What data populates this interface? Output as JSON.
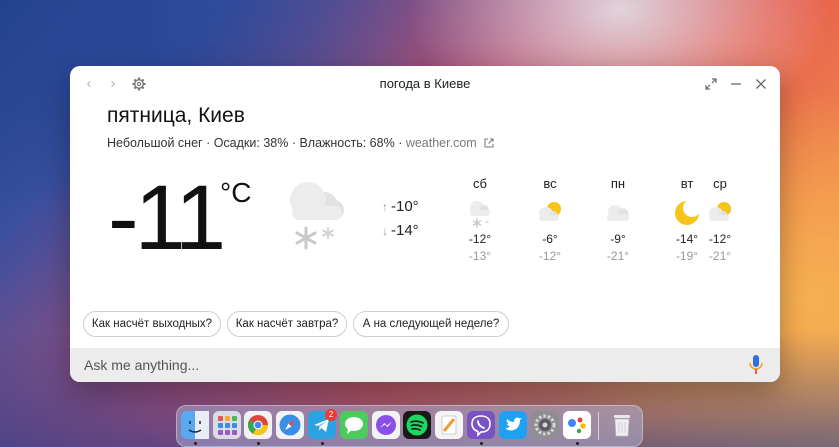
{
  "window": {
    "title": "погода в Киеве",
    "nav_back": "‹",
    "nav_forward": "›"
  },
  "weather": {
    "heading": "пятница, Киев",
    "condition": "Небольшой снег",
    "precip": "Осадки: 38%",
    "humidity": "Влажность: 68%",
    "separator": " · ",
    "source": "weather.com",
    "current_temp": "-11",
    "unit": "°C",
    "high": "-10°",
    "low": "-14°"
  },
  "forecast": [
    {
      "day": "сб",
      "icon": "snow-cloud-icon",
      "high": "-12°",
      "low": "-13°"
    },
    {
      "day": "вс",
      "icon": "partly-cloudy-icon",
      "high": "-6°",
      "low": "-12°"
    },
    {
      "day": "пн",
      "icon": "cloudy-icon",
      "high": "-9°",
      "low": "-21°"
    },
    {
      "day": "вт",
      "icon": "moon-icon",
      "high": "-14°",
      "low": "-19°"
    },
    {
      "day": "ср",
      "icon": "partly-cloudy-icon",
      "high": "-12°",
      "low": "-21°"
    }
  ],
  "suggestions": [
    "Как насчёт выходных?",
    "Как насчёт завтра?",
    "А на следующей неделе?"
  ],
  "ask": {
    "placeholder": "Ask me anything..."
  },
  "dock": {
    "telegram_badge": "2",
    "apps": [
      "finder",
      "launchpad",
      "chrome",
      "safari",
      "telegram",
      "messages",
      "messenger",
      "spotify",
      "pages",
      "viber",
      "twitter",
      "system-preferences",
      "google-assistant",
      "trash"
    ]
  },
  "colors": {
    "accent_blue": "#2f6fe0",
    "sun": "#f5c518",
    "cloud": "#d8d8d8"
  }
}
